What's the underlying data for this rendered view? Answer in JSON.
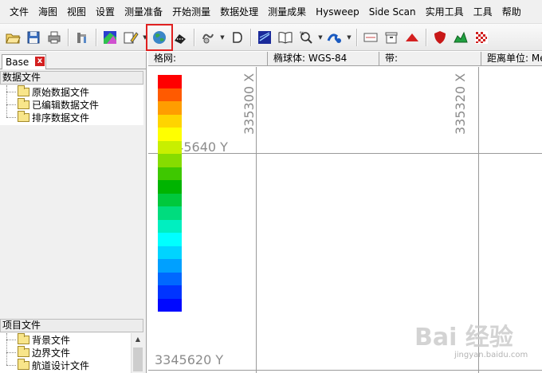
{
  "menu": [
    "文件",
    "海图",
    "视图",
    "设置",
    "测量准备",
    "开始测量",
    "数据处理",
    "测量成果",
    "Hysweep",
    "Side Scan",
    "实用工具",
    "工具",
    "帮助"
  ],
  "toolbar": {
    "buttons": [
      {
        "name": "open-icon"
      },
      {
        "name": "save-icon"
      },
      {
        "name": "print-icon"
      },
      {
        "name": "hardware-icon"
      },
      {
        "name": "chart-icon"
      },
      {
        "name": "edit-icon"
      },
      {
        "name": "globe-icon"
      },
      {
        "name": "survey-boat-icon"
      },
      {
        "name": "tide-icon"
      },
      {
        "name": "d-icon"
      },
      {
        "name": "matrix-icon"
      },
      {
        "name": "book-icon"
      },
      {
        "name": "sounding-icon"
      },
      {
        "name": "wave-icon"
      },
      {
        "name": "panel-icon"
      },
      {
        "name": "archive-icon"
      },
      {
        "name": "tin-icon"
      },
      {
        "name": "shield-icon"
      },
      {
        "name": "terrain-icon"
      },
      {
        "name": "grid-icon"
      }
    ]
  },
  "left_panel": {
    "tab_label": "Base",
    "close_label": "x",
    "data_files": {
      "header": "数据文件",
      "items": [
        "原始数据文件",
        "已编辑数据文件",
        "排序数据文件"
      ]
    },
    "project_files": {
      "header": "项目文件",
      "items": [
        "背景文件",
        "边界文件",
        "航道设计文件"
      ]
    }
  },
  "map_header": {
    "grid": "格网:",
    "ellipsoid": "椭球体: WGS-84",
    "zone": "带:",
    "distance_unit": "距离单位: Me"
  },
  "map": {
    "labels": {
      "x_left": "335300 X",
      "x_right": "335320 X",
      "y_top": "345640 Y",
      "y_bottom": "3345620 Y"
    },
    "colorbar": [
      "#ff0000",
      "#ff5a00",
      "#ff9d00",
      "#ffd400",
      "#ffff00",
      "#c8ef00",
      "#86dc00",
      "#3ec800",
      "#00b400",
      "#00c83c",
      "#00dc7e",
      "#00efc0",
      "#00ffff",
      "#00d4ff",
      "#00a0ff",
      "#0068ff",
      "#0034ff",
      "#0008ff"
    ]
  },
  "watermark": {
    "main": "Bai 经验",
    "sub": "jingyan.baidu.com"
  }
}
